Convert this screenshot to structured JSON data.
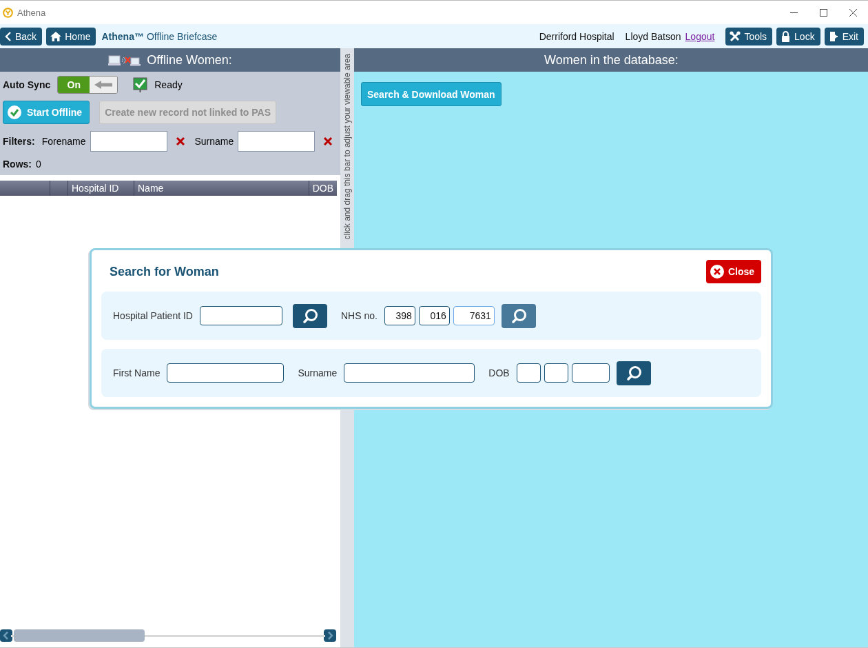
{
  "window": {
    "title": "Athena"
  },
  "toolbar": {
    "left_buttons": [
      {
        "label": "Back",
        "kind": "back"
      },
      {
        "label": "Home",
        "kind": "home"
      }
    ],
    "app_name": "Athena™",
    "page_title": "Offline Briefcase",
    "hospital": "Derriford Hospital",
    "user": "Lloyd Batson",
    "logout": "Logout",
    "right_buttons": [
      {
        "label": "Tools",
        "kind": "tools"
      },
      {
        "label": "Lock",
        "kind": "lock"
      },
      {
        "label": "Exit",
        "kind": "exit"
      }
    ]
  },
  "offline_panel": {
    "title": "Offline Women:",
    "auto_sync": {
      "label": "Auto Sync",
      "toggle": "On",
      "on": true
    },
    "status": {
      "label": "Ready",
      "checked": true
    },
    "start_button": "Start Offline",
    "create_button": {
      "label": "Create new record not linked to PAS",
      "disabled": true
    },
    "filters": {
      "label": "Filters:",
      "fields": [
        {
          "label": "Forename"
        },
        {
          "label": "Surname"
        }
      ]
    },
    "rows": {
      "label": "Rows:",
      "value": "0"
    },
    "table": {
      "columns": [
        "Hospital ID",
        "Name",
        "DOB"
      ]
    }
  },
  "splitter": {
    "hint": "click and drag this bar to adjust your viewable area"
  },
  "database_panel": {
    "title": "Women in the database:",
    "button": "Search & Download Woman"
  },
  "search_dialog": {
    "title": "Search for Woman",
    "close": "Close",
    "sections": [
      {
        "items": [
          {
            "kind": "label",
            "text": "Hospital Patient ID"
          },
          {
            "kind": "field",
            "focused": false
          },
          {
            "kind": "search",
            "hover": false
          },
          {
            "kind": "label",
            "text": "NHS no."
          },
          {
            "kind": "part",
            "value": "398",
            "focused": false
          },
          {
            "kind": "part",
            "value": "016",
            "focused": false
          },
          {
            "kind": "part",
            "value": "7631",
            "focused": true
          },
          {
            "kind": "search",
            "hover": true
          }
        ]
      },
      {
        "items": [
          {
            "kind": "label",
            "text": "First Name"
          },
          {
            "kind": "field",
            "focused": false
          },
          {
            "kind": "label",
            "text": "Surname"
          },
          {
            "kind": "field",
            "focused": false
          },
          {
            "kind": "label",
            "text": "DOB"
          },
          {
            "kind": "part",
            "focused": false
          },
          {
            "kind": "part",
            "focused": false
          },
          {
            "kind": "part",
            "focused": false
          },
          {
            "kind": "search",
            "hover": false
          }
        ]
      }
    ]
  }
}
